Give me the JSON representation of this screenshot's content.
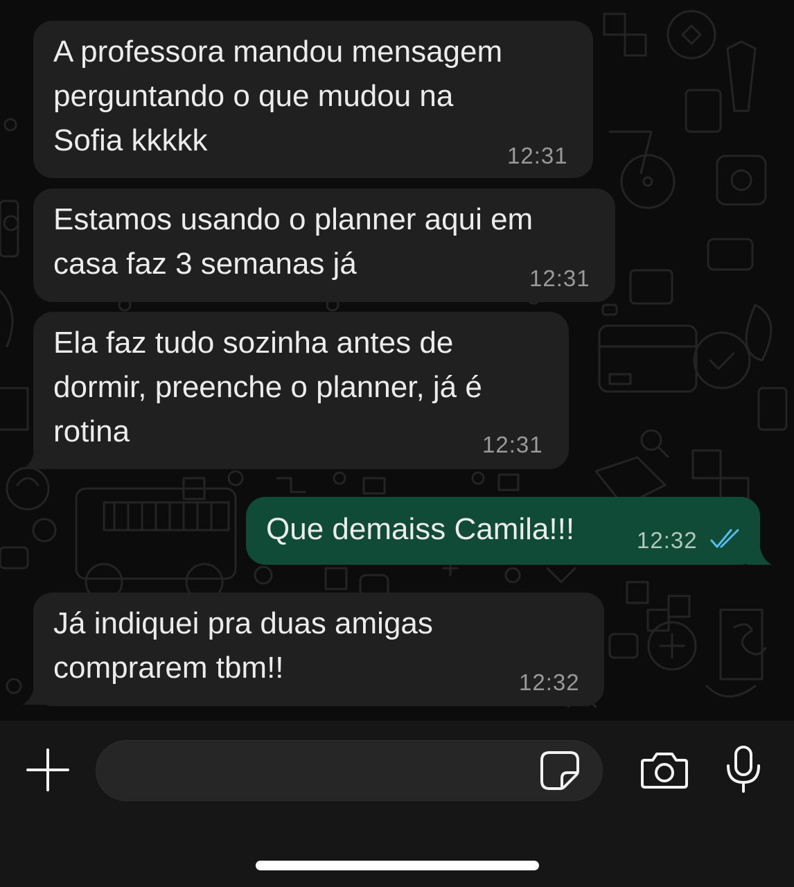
{
  "messages": [
    {
      "direction": "incoming",
      "text": "A professora mandou mensagem\nperguntando o que mudou na\nSofia kkkkk",
      "time": "12:31"
    },
    {
      "direction": "incoming",
      "text": "Estamos usando o planner aqui em\ncasa faz 3 semanas já",
      "time": "12:31"
    },
    {
      "direction": "incoming",
      "text": "Ela faz tudo sozinha antes de\ndormir, preenche o planner, já é\nrotina",
      "time": "12:31"
    },
    {
      "direction": "outgoing",
      "text": "Que demaiss Camila!!!",
      "time": "12:32",
      "status_icon": "double-check-read-icon"
    },
    {
      "direction": "incoming",
      "text": "Já indiquei pra duas amigas\ncomprarem tbm!!",
      "time": "12:32"
    }
  ],
  "composer": {
    "placeholder": "",
    "icons": [
      "plus-icon",
      "sticker-icon",
      "camera-icon",
      "microphone-icon"
    ]
  },
  "colors": {
    "incoming_bubble": "#202020",
    "outgoing_bubble": "#0f4b36",
    "read_ticks": "#53bdeb",
    "background": "#0b0b0b"
  }
}
